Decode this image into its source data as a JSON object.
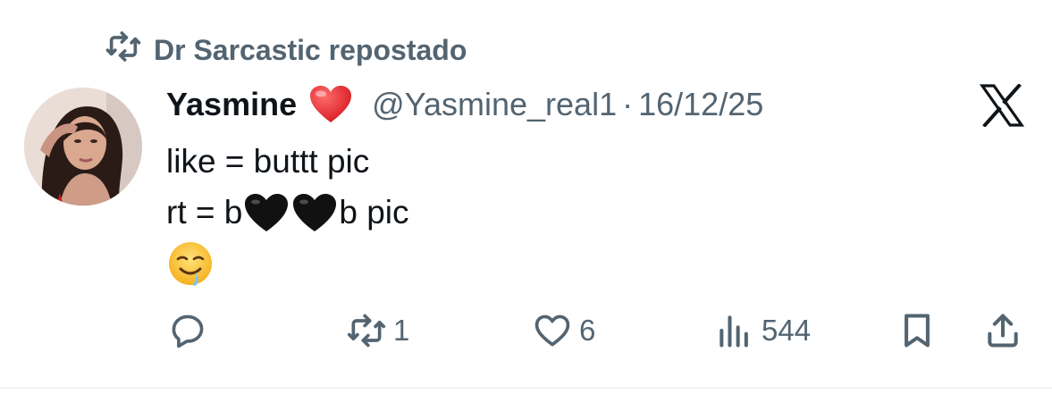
{
  "repost": {
    "text": "Dr Sarcastic repostado",
    "icon": "repost-icon"
  },
  "author": {
    "name": "Yasmine",
    "badge_icon": "red-heart-emoji",
    "handle": "@Yasmine_real1",
    "separator": "·",
    "date": "16/12/25"
  },
  "platform_icon": "x-logo-icon",
  "post": {
    "line1": "like = buttt pic",
    "line2_prefix": "rt = b",
    "line2_suffix": "b pic",
    "line2_icons": [
      "black-heart-emoji",
      "black-heart-emoji"
    ],
    "line3_icon": "drooling-face-emoji"
  },
  "actions": {
    "reply_count": "",
    "repost_count": "1",
    "like_count": "6",
    "views_count": "544"
  },
  "colors": {
    "text": "#0f1419",
    "secondary": "#536471",
    "heart": "#e0245e"
  }
}
